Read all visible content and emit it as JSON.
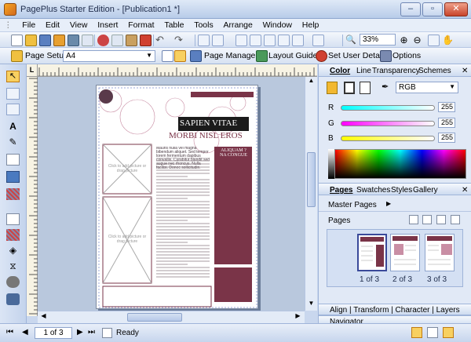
{
  "window": {
    "title": "PagePlus Starter Edition - [Publication1 *]"
  },
  "menu": [
    "File",
    "Edit",
    "View",
    "Insert",
    "Format",
    "Table",
    "Tools",
    "Arrange",
    "Window",
    "Help"
  ],
  "toolbar1": {
    "zoom": "33%"
  },
  "toolbar2": {
    "page_setup": "Page Setup",
    "paper": "A4",
    "page_manager": "Page Manager",
    "layout_guides": "Layout Guides",
    "user_details": "Set User Details",
    "options": "Options"
  },
  "ruler": {
    "corner": "L"
  },
  "document": {
    "heading1": "SAPIEN VITAE",
    "heading2": "MORBI NISL EROS",
    "side_heading": "ALIQUAM ?\nNA CONGUE",
    "picture_label": "Click to add picture or drag picture",
    "body_text": "Mauris nulla vel magna bibendum aliquet. Sed tempor lorem fermentum dapibus convallis. Curabitur blandit sed augue nec rhoncus. Nulla facilisi. Donec sollicitudin."
  },
  "color_panel": {
    "tabs": [
      "Color",
      "Line",
      "Transparency",
      "Schemes"
    ],
    "mode": "RGB",
    "r_label": "R",
    "g_label": "G",
    "b_label": "B",
    "r": "255",
    "g": "255",
    "b": "255"
  },
  "pages_panel": {
    "tabs": [
      "Pages",
      "Swatches",
      "Styles",
      "Gallery"
    ],
    "master_pages": "Master Pages",
    "pages": "Pages",
    "thumbs": [
      "1 of 3",
      "2 of 3",
      "3 of 3"
    ]
  },
  "collapsed_panels": {
    "row1": "Align | Transform | Character | Layers",
    "row2": "Navigator"
  },
  "status": {
    "page": "1 of 3",
    "ready": "Ready"
  },
  "colors": {
    "accent": "#7a3448",
    "panel": "#e1e9f6"
  }
}
